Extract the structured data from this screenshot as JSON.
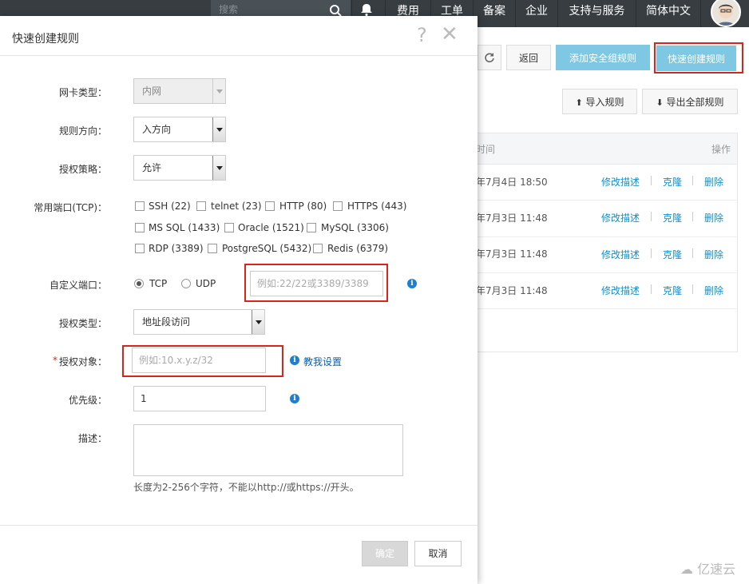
{
  "topnav": {
    "search_placeholder": "搜索",
    "items": [
      "费用",
      "工单",
      "备案",
      "企业",
      "支持与服务",
      "简体中文"
    ]
  },
  "background": {
    "refresh_icon": "refresh-icon",
    "back": "返回",
    "add_sg_rule": "添加安全组规则",
    "quick_create": "快速创建规则",
    "import_rules": "导入规则",
    "export_all": "导出全部规则",
    "col_time": "时间",
    "col_ops": "操作",
    "rows": [
      {
        "time": "年7月4日 18:50"
      },
      {
        "time": "年7月3日 11:48"
      },
      {
        "time": "年7月3日 11:48"
      },
      {
        "time": "年7月3日 11:48"
      }
    ],
    "row_actions": [
      "修改描述",
      "克隆",
      "删除"
    ]
  },
  "dialog": {
    "title": "快速创建规则",
    "nic_label": "网卡类型：",
    "nic_value": "内网",
    "direction_label": "规则方向：",
    "direction_value": "入方向",
    "policy_label": "授权策略：",
    "policy_value": "允许",
    "ports_label": "常用端口(TCP)：",
    "ports": [
      [
        "SSH (22)",
        "telnet (23)",
        "HTTP (80)",
        "HTTPS (443)"
      ],
      [
        "MS SQL (1433)",
        "Oracle (1521)",
        "MySQL (3306)"
      ],
      [
        "RDP (3389)",
        "PostgreSQL (5432)",
        "Redis (6379)"
      ]
    ],
    "custom_port_label": "自定义端口：",
    "proto_tcp": "TCP",
    "proto_udp": "UDP",
    "port_placeholder": "例如:22/22或3389/3389",
    "auth_type_label": "授权类型：",
    "auth_type_value": "地址段访问",
    "required_mark": "*",
    "auth_obj_label": "授权对象：",
    "auth_obj_placeholder": "例如:10.x.y.z/32",
    "teach_link": "教我设置",
    "priority_label": "优先级：",
    "priority_value": "1",
    "desc_label": "描述：",
    "desc_hint": "长度为2-256个字符，不能以http://或https://开头。",
    "ok": "确定",
    "cancel": "取消",
    "help_glyph": "?",
    "close_glyph": "✕",
    "info_glyph": "i"
  },
  "watermark": "亿速云",
  "colors": {
    "highlight": "#d9241b",
    "accent": "#7ec8e3",
    "link": "#0b8fd6"
  }
}
